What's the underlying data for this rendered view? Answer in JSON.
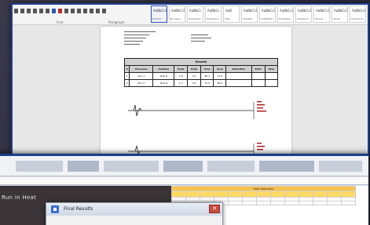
{
  "word": {
    "ribbon": {
      "font_group_label": "Font",
      "paragraph_group_label": "Paragraph",
      "styles": [
        {
          "sample": "AaBbCcDd",
          "name": "Normal"
        },
        {
          "sample": "AaBbCcDd",
          "name": "No Spac..."
        },
        {
          "sample": "AaBbCc",
          "name": "Heading 1"
        },
        {
          "sample": "AaBbCc",
          "name": "Heading 2"
        },
        {
          "sample": "AaB",
          "name": "Title"
        },
        {
          "sample": "AaBbCcDd",
          "name": "Subtitle"
        },
        {
          "sample": "AaBbCcDd",
          "name": "Subtle Em..."
        },
        {
          "sample": "AaBbCcDd",
          "name": "Emphasis"
        },
        {
          "sample": "AaBbCcDd",
          "name": "Intense E..."
        },
        {
          "sample": "AaBbCcDd",
          "name": "Strong"
        },
        {
          "sample": "AaBbCcDd",
          "name": "Quote"
        },
        {
          "sample": "AaBbCcDd",
          "name": "Intense Q..."
        },
        {
          "sample": "AaBbCcDd",
          "name": "Subtle Ref..."
        }
      ]
    },
    "table": {
      "caption": "Results",
      "headers": [
        "#",
        "Filename",
        "Position",
        "Peak",
        "Peak",
        "Area",
        "Area",
        "Retention",
        "Start",
        "Stop"
      ],
      "rows": [
        [
          "1",
          "Run 1",
          "Row B",
          "1.8",
          "2.1",
          "88.1",
          "71.4",
          "",
          "",
          ""
        ],
        [
          "2",
          "Run 2",
          "Row B",
          "1.7",
          "0.4",
          "75.9",
          "68.4",
          "",
          "",
          ""
        ]
      ]
    }
  },
  "excel": {
    "app_title": "Run in Heat",
    "formula_a": "",
    "formula_b": "",
    "sheet_title": "Area Summary"
  },
  "dialog": {
    "title": "Final Results",
    "close_glyph": "✕"
  }
}
